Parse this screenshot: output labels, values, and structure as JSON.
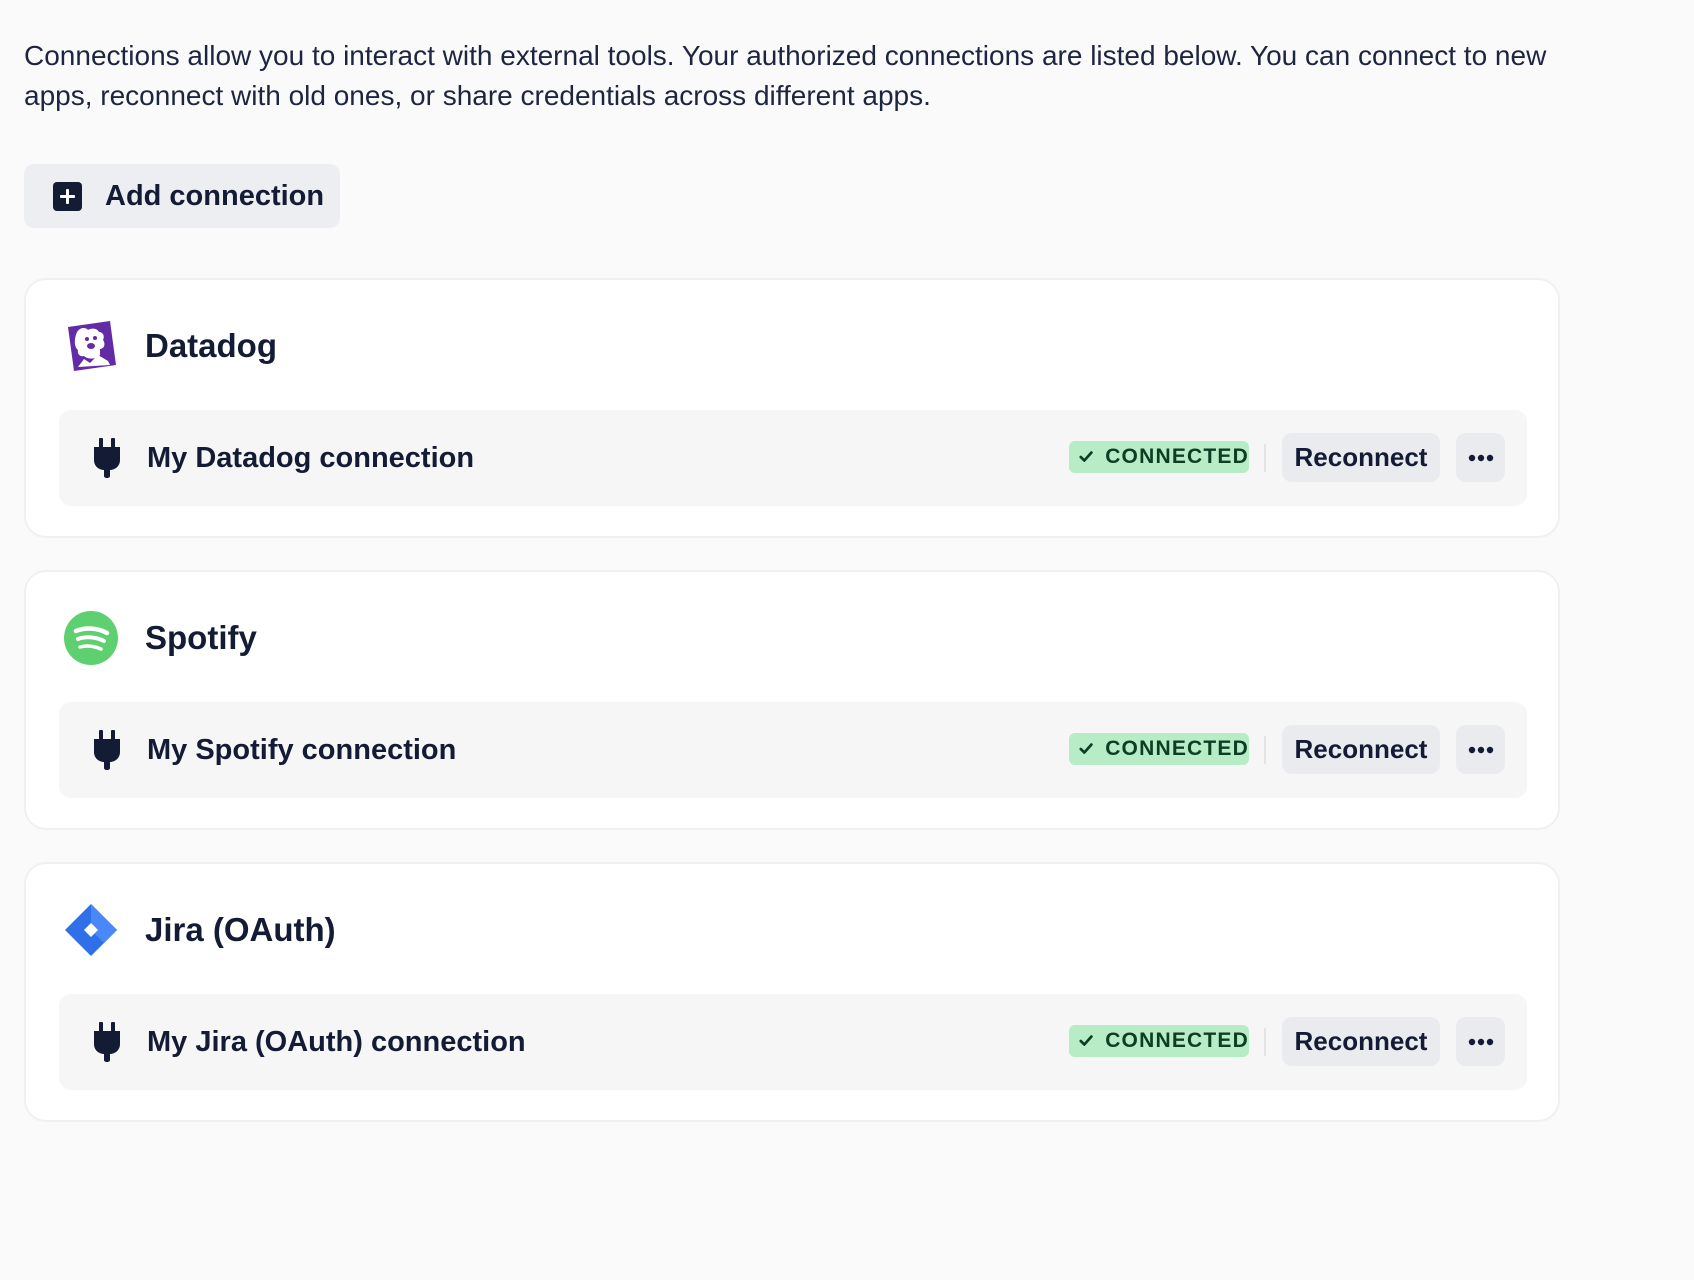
{
  "intro_text": "Connections allow you to interact with external tools. Your authorized connections are listed below. You can connect to new apps, reconnect with old ones, or share credentials across different apps.",
  "add_button": {
    "label": "Add connection",
    "icon": "plus-square-icon"
  },
  "apps": [
    {
      "name": "Datadog",
      "logo": "datadog-logo",
      "connection": {
        "name": "My Datadog connection",
        "status": "CONNECTED",
        "reconnect_label": "Reconnect",
        "more_icon": "more-horizontal-icon"
      }
    },
    {
      "name": "Spotify",
      "logo": "spotify-logo",
      "connection": {
        "name": "My Spotify connection",
        "status": "CONNECTED",
        "reconnect_label": "Reconnect",
        "more_icon": "more-horizontal-icon"
      }
    },
    {
      "name": "Jira (OAuth)",
      "logo": "jira-logo",
      "connection": {
        "name": "My Jira (OAuth) connection",
        "status": "CONNECTED",
        "reconnect_label": "Reconnect",
        "more_icon": "more-horizontal-icon"
      }
    }
  ],
  "colors": {
    "background": "#fafafa",
    "text": "#141b34",
    "status_bg": "#b7ecc7",
    "status_text": "#0f3d24",
    "spotify_green": "#5fd06f",
    "jira_blue": "#2f6fe8",
    "datadog_purple": "#632ca6"
  }
}
